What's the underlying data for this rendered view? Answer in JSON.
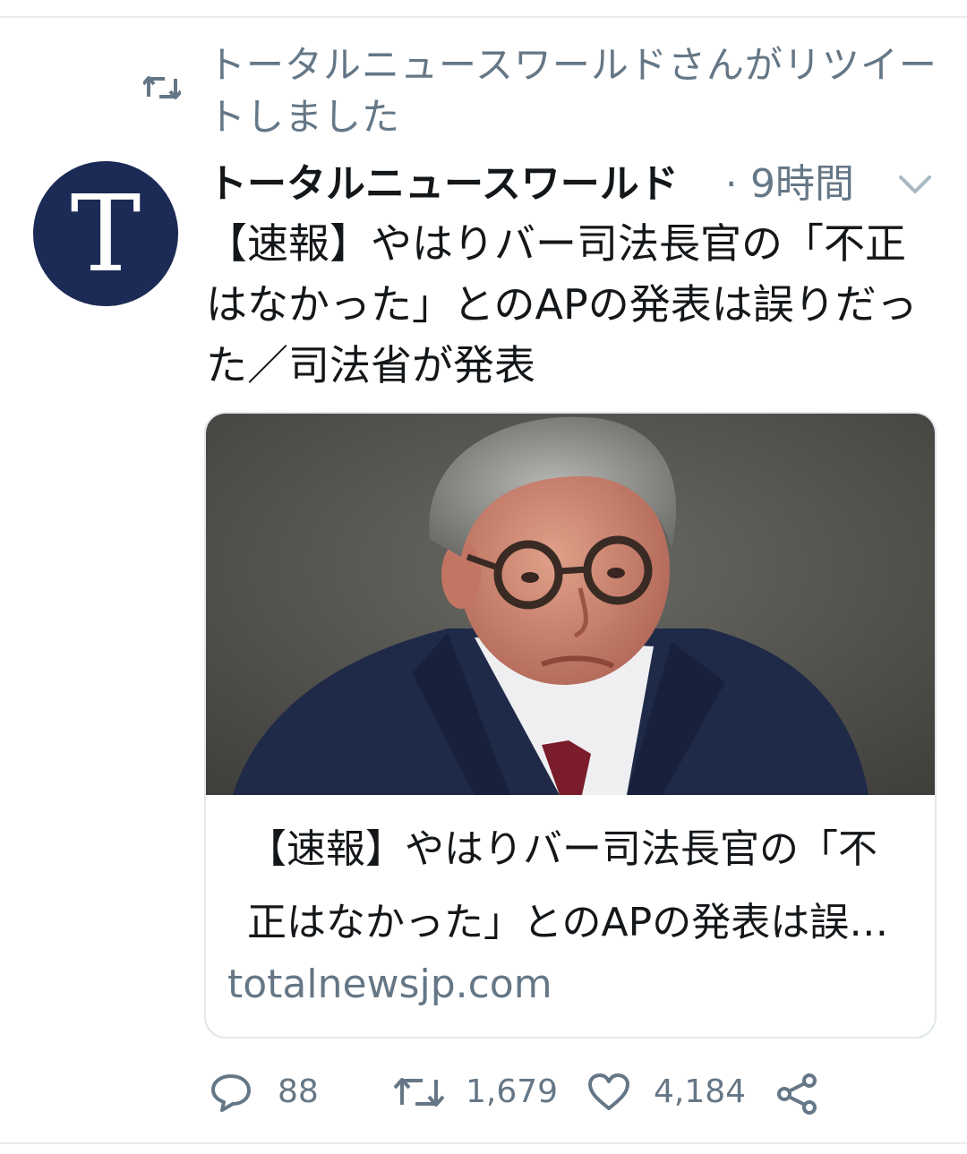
{
  "retweet_context": {
    "text": "トータルニュースワールドさんがリツイートしました",
    "icon": "retweet-icon"
  },
  "tweet": {
    "avatar_letter": "T",
    "author_name": "トータルニュースワールド",
    "separator": "·",
    "timestamp": "9時間",
    "menu_icon": "chevron-down-icon",
    "text": "【速報】やはりバー司法長官の「不正はなかった」とのAPの発表は誤りだった／司法省が発表"
  },
  "card": {
    "title": "【速報】やはりバー司法長官の「不正はなかった」とのAPの発表は誤りだった／司法省が発表",
    "domain": "totalnewsjp.com"
  },
  "actions": {
    "reply_count": "88",
    "retweet_count": "1,679",
    "like_count": "4,184"
  },
  "colors": {
    "secondary_text": "#657786",
    "avatar_bg": "#1c2b55",
    "border": "#e1e8ed"
  }
}
